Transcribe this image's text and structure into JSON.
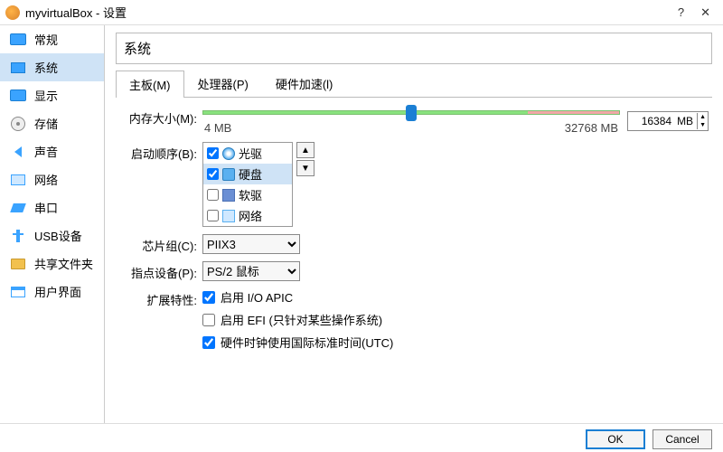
{
  "window": {
    "title": "myvirtualBox - 设置"
  },
  "sidebar": {
    "items": [
      {
        "label": "常规"
      },
      {
        "label": "系统"
      },
      {
        "label": "显示"
      },
      {
        "label": "存储"
      },
      {
        "label": "声音"
      },
      {
        "label": "网络"
      },
      {
        "label": "串口"
      },
      {
        "label": "USB设备"
      },
      {
        "label": "共享文件夹"
      },
      {
        "label": "用户界面"
      }
    ]
  },
  "main": {
    "section_title": "系统",
    "tabs": [
      {
        "label": "主板(M)"
      },
      {
        "label": "处理器(P)"
      },
      {
        "label": "硬件加速(l)"
      }
    ],
    "memory": {
      "label": "内存大小(M):",
      "min_label": "4 MB",
      "max_label": "32768 MB",
      "value": "16384",
      "unit": "MB"
    },
    "boot": {
      "label": "启动顺序(B):",
      "items": [
        {
          "label": "光驱",
          "checked": true
        },
        {
          "label": "硬盘",
          "checked": true
        },
        {
          "label": "软驱",
          "checked": false
        },
        {
          "label": "网络",
          "checked": false
        }
      ]
    },
    "chipset": {
      "label": "芯片组(C):",
      "value": "PIIX3"
    },
    "pointing": {
      "label": "指点设备(P):",
      "value": "PS/2 鼠标"
    },
    "extended": {
      "label": "扩展特性:",
      "opts": [
        {
          "label": "启用 I/O APIC",
          "checked": true
        },
        {
          "label": "启用 EFI (只针对某些操作系统)",
          "checked": false
        },
        {
          "label": "硬件时钟使用国际标准时间(UTC)",
          "checked": true
        }
      ]
    }
  },
  "footer": {
    "ok": "OK",
    "cancel": "Cancel"
  }
}
